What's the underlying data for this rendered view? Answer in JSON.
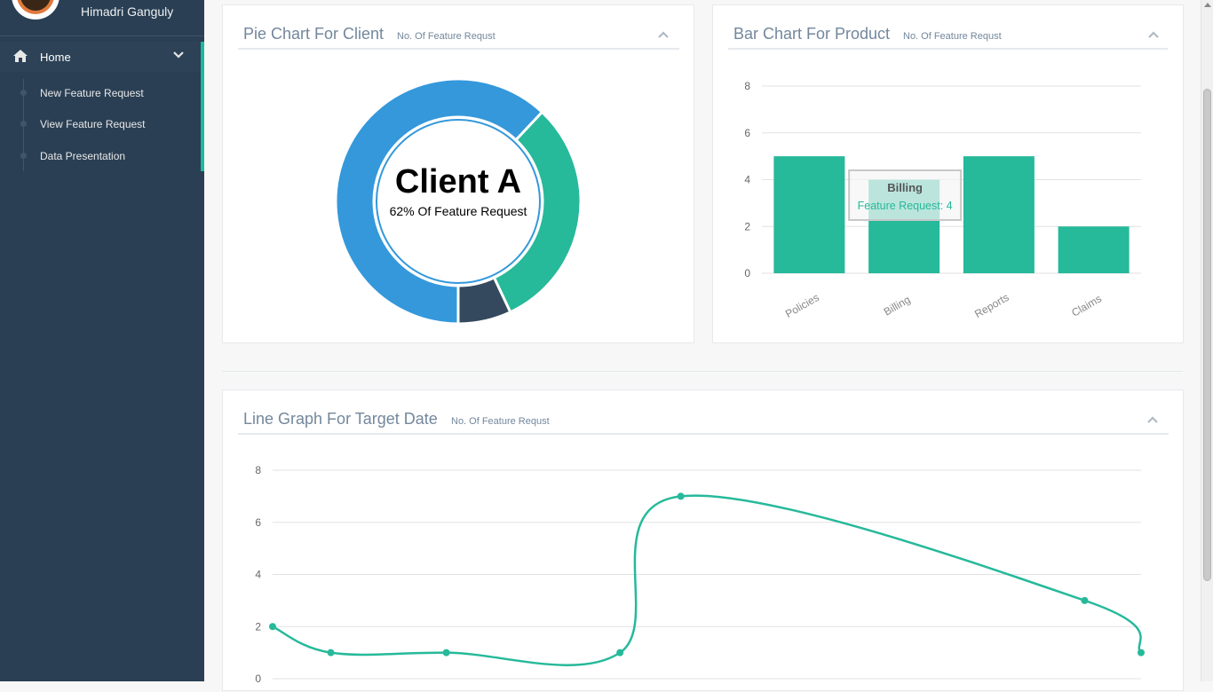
{
  "sidebar": {
    "user_name": "Himadri Ganguly",
    "menu": {
      "home_label": "Home",
      "home_icon": "home-icon",
      "expand_icon": "chevron-down-icon"
    },
    "submenu": [
      {
        "label": "New Feature Request"
      },
      {
        "label": "View Feature Request"
      },
      {
        "label": "Data Presentation"
      }
    ],
    "colors": {
      "background": "#2a3f54",
      "accent": "#1abb9c"
    }
  },
  "panels": {
    "pie": {
      "title": "Pie Chart For Client",
      "subtitle": "No. Of Feature Requst",
      "collapse_icon": "chevron-up-icon"
    },
    "bar": {
      "title": "Bar Chart For Product",
      "subtitle": "No. Of Feature Requst",
      "collapse_icon": "chevron-up-icon"
    },
    "line": {
      "title": "Line Graph For Target Date",
      "subtitle": "No. Of Feature Requst",
      "collapse_icon": "chevron-up-icon"
    }
  },
  "chart_data": [
    {
      "type": "pie",
      "center_title": "Client A",
      "center_subtitle": "62% Of Feature Request",
      "slices": [
        {
          "value": 62,
          "color": "#3498db"
        },
        {
          "value": 31,
          "color": "#26b99a"
        },
        {
          "value": 7,
          "color": "#34495e"
        }
      ]
    },
    {
      "type": "bar",
      "categories": [
        "Policies",
        "Billing",
        "Reports",
        "Claims"
      ],
      "values": [
        5,
        4,
        5,
        2
      ],
      "ylim": [
        0,
        8
      ],
      "yticks": [
        "0",
        "2",
        "4",
        "6",
        "8"
      ],
      "grid": true,
      "color": "#26b99a",
      "tooltip": {
        "category": "Billing",
        "text": "Feature Request: 4"
      }
    },
    {
      "type": "line",
      "values": [
        2,
        1,
        1,
        1,
        7,
        3,
        1
      ],
      "ylim": [
        0,
        8
      ],
      "yticks": [
        "0",
        "2",
        "4",
        "6",
        "8"
      ],
      "grid": true,
      "color": "#26b99a"
    }
  ]
}
